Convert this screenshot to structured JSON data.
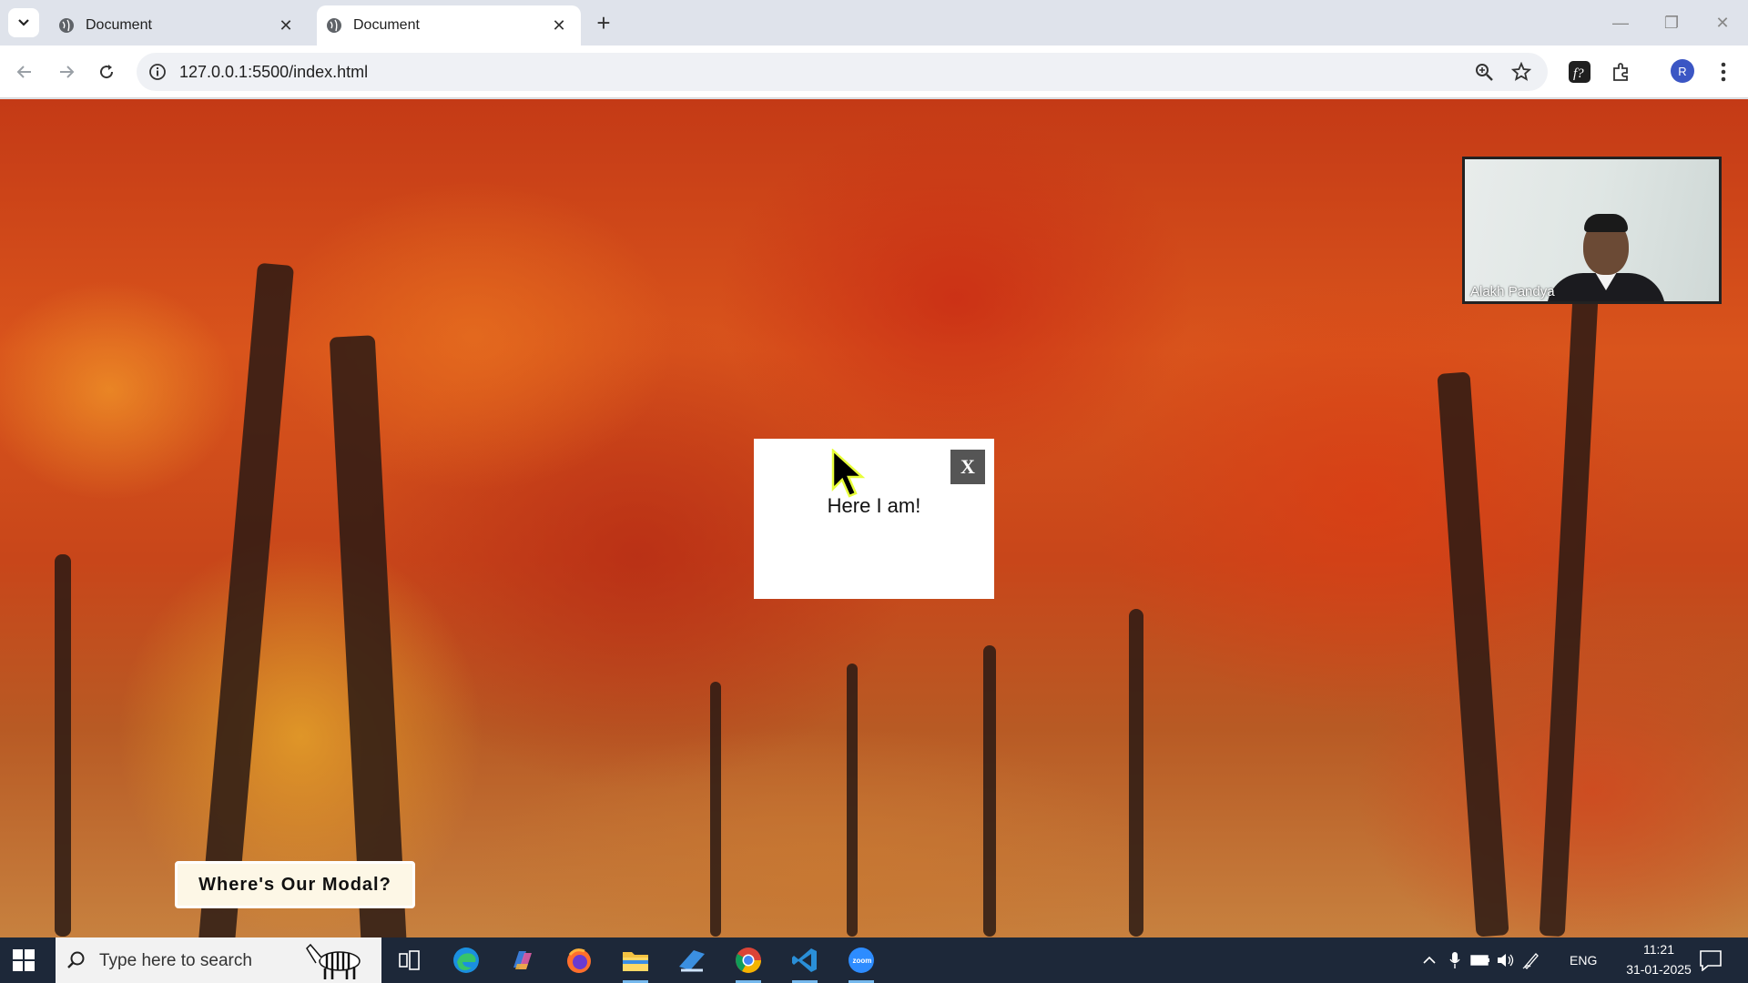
{
  "browser": {
    "tabs": [
      {
        "title": "Document",
        "active": false
      },
      {
        "title": "Document",
        "active": true
      }
    ],
    "url": "127.0.0.1:5500/index.html",
    "profile_initial": "R"
  },
  "page": {
    "modal": {
      "close_label": "X",
      "text": "Here I am!"
    },
    "open_button_label": "Where's Our Modal?",
    "video_overlay": {
      "participant_name": "Alakh Pandya"
    }
  },
  "taskbar": {
    "search_placeholder": "Type here to search",
    "language": "ENG",
    "time": "11:21",
    "date": "31-01-2025",
    "pinned_apps": [
      "task-view",
      "edge",
      "copilot",
      "firefox",
      "file-explorer",
      "app",
      "chrome",
      "vscode",
      "zoom"
    ]
  },
  "colors": {
    "accent_profile": "#3b56c4",
    "taskbar_bg": "#1d2839",
    "modal_close_bg": "#555555",
    "page_button_bg": "#fdf7e6"
  }
}
